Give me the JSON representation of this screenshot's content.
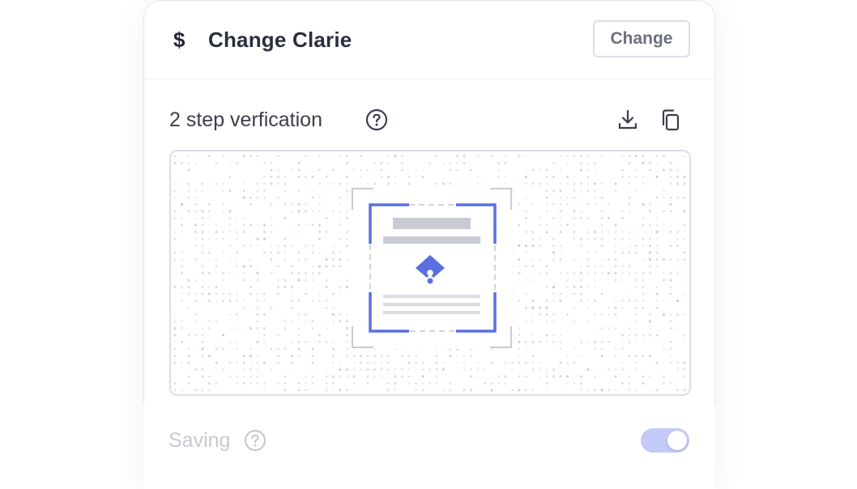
{
  "header": {
    "icon": "dollar-icon",
    "title": "Change Clarie",
    "change_label": "Change"
  },
  "verification": {
    "label": "2 step verfication",
    "help_icon": "question-circle-icon",
    "actions": [
      "download-icon",
      "copy-icon"
    ]
  },
  "qr_scan": {
    "accent_color": "#5a6fe0",
    "muted_color": "#c9cbd2"
  },
  "saving": {
    "label": "Saving",
    "help_icon": "question-circle-icon",
    "toggle_on": true
  },
  "colors": {
    "border": "#dcdfe6",
    "toggle_bg": "#c4caf7",
    "text_primary": "#2a2f3d",
    "text_muted": "#c7c9d1"
  }
}
